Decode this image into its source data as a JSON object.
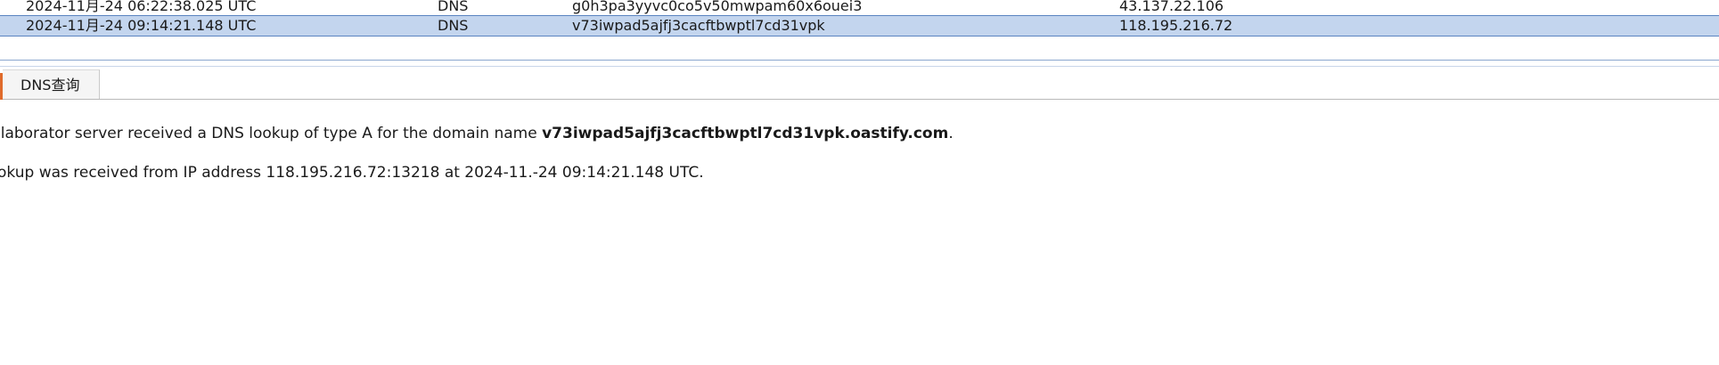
{
  "interactions": [
    {
      "time": "2024-11月-24 06:22:38.025 UTC",
      "type": "DNS",
      "payload": "g0h3pa3yyvc0co5v50mwpam60x6ouei3",
      "source_ip": "43.137.22.106"
    },
    {
      "time": "2024-11月-24 09:14:21.148 UTC",
      "type": "DNS",
      "payload": "v73iwpad5ajfj3cacftbwptl7cd31vpk",
      "source_ip": "118.195.216.72"
    }
  ],
  "tabs": [
    {
      "label": "DNS查询"
    }
  ],
  "details": {
    "line1_prefix": "llaborator server received a DNS lookup of type A for the domain name ",
    "line1_domain": "v73iwpad5ajfj3cacftbwptl7cd31vpk.oastify.com",
    "line1_suffix": ".",
    "line2": "okup was received from IP address 118.195.216.72:13218 at 2024-11.-24 09:14:21.148 UTC."
  },
  "colors": {
    "selected_row_bg": "#c3d5ee",
    "selected_row_border": "#5a84c1",
    "tab_accent": "#e06b2c"
  }
}
